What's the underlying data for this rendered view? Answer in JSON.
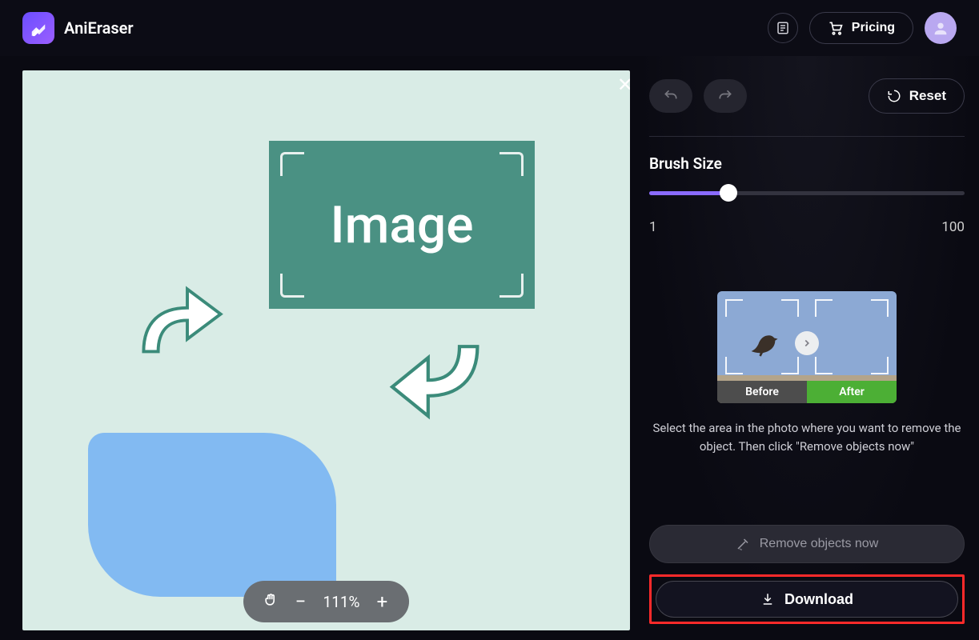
{
  "header": {
    "app_name": "AniEraser",
    "pricing_label": "Pricing"
  },
  "canvas": {
    "placeholder_label": "Image"
  },
  "zoom": {
    "level": "111%"
  },
  "side": {
    "reset_label": "Reset",
    "brush_label": "Brush Size",
    "brush_min": "1",
    "brush_max": "100",
    "before_label": "Before",
    "after_label": "After",
    "hint": "Select the area in the photo where you want to remove the object. Then click \"Remove objects now\"",
    "remove_label": "Remove objects now",
    "download_label": "Download"
  }
}
